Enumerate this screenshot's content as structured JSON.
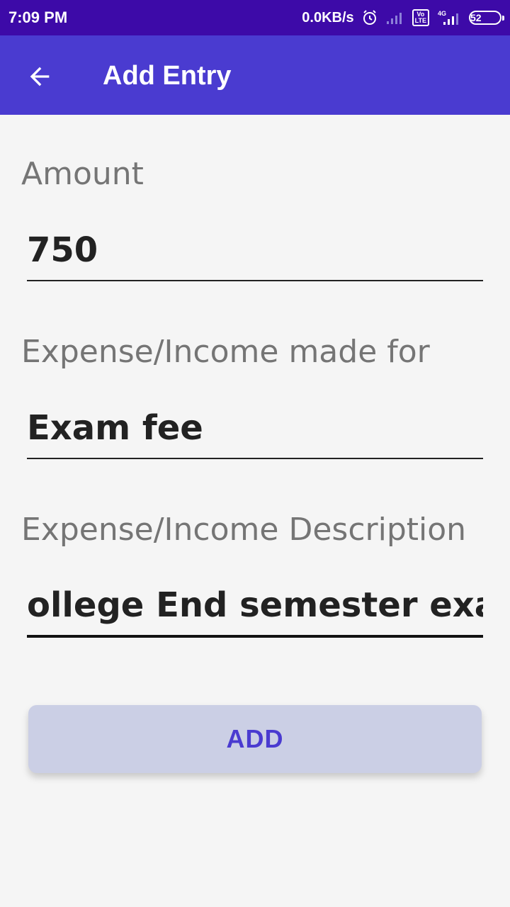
{
  "status_bar": {
    "time": "7:09 PM",
    "network_speed": "0.0KB/s",
    "network_type": "4G",
    "volte": "Vo LTE",
    "battery_level": "52",
    "icons": [
      "alarm-icon",
      "signal-icon",
      "volte-icon",
      "signal-4g-icon",
      "battery-icon"
    ]
  },
  "app_bar": {
    "title": "Add Entry",
    "back_icon": "arrow-left-icon",
    "color": "#4a3bd0"
  },
  "form": {
    "amount_label": "Amount",
    "amount_value": "750",
    "made_for_label": "Expense/Income made for",
    "made_for_value": "Exam fee",
    "description_label": "Expense/Income Description",
    "description_value": "ollege End semester exar"
  },
  "actions": {
    "add_label": "ADD"
  },
  "colors": {
    "status_bar": "#3d0aa8",
    "app_bar": "#4a3bd0",
    "button_bg": "#cbcfe5",
    "button_text": "#4a3bd0"
  }
}
